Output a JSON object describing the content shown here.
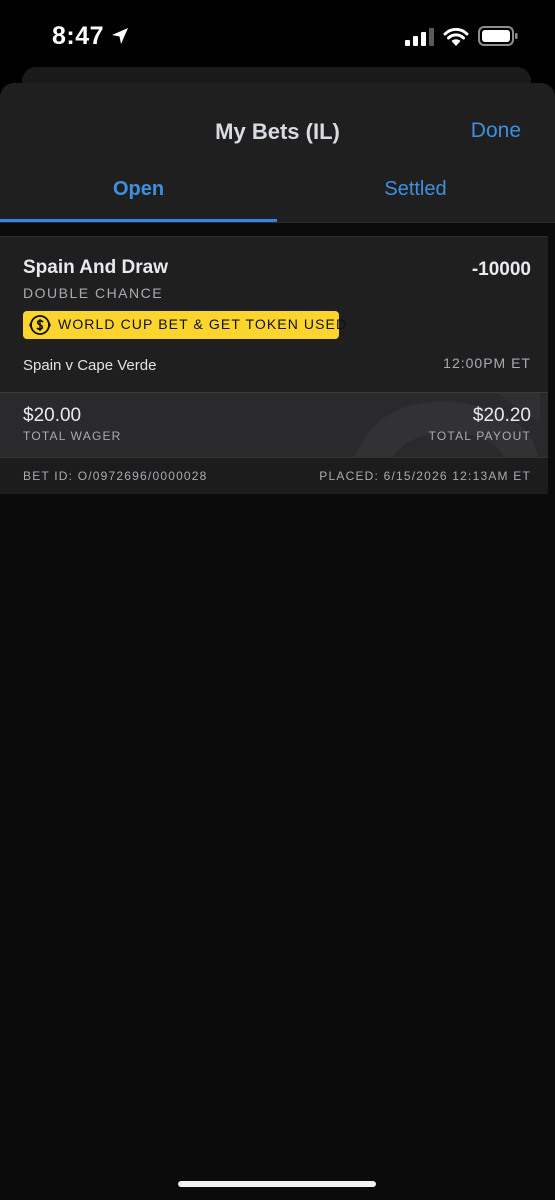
{
  "status_bar": {
    "time": "8:47"
  },
  "sheet": {
    "title": "My Bets (IL)",
    "done_label": "Done"
  },
  "tabs": [
    {
      "label": "Open",
      "active": true
    },
    {
      "label": "Settled",
      "active": false
    }
  ],
  "bet": {
    "selection": "Spain And Draw",
    "market": "DOUBLE CHANCE",
    "odds": "-10000",
    "token_badge": "WORLD CUP BET & GET TOKEN USED",
    "event": "Spain v Cape Verde",
    "event_time": "12:00PM ET",
    "wager_amount": "$20.00",
    "wager_label": "TOTAL WAGER",
    "payout_amount": "$20.20",
    "payout_label": "TOTAL PAYOUT",
    "bet_id": "BET ID: O/0972696/0000028",
    "placed": "PLACED: 6/15/2026 12:13AM ET"
  },
  "colors": {
    "accent_blue": "#3d8fe0",
    "badge_yellow": "#fbd52d",
    "sheet_bg": "#1f1f20",
    "page_bg": "#0b0b0b"
  },
  "icons": {
    "location": "location-arrow-icon",
    "signal": "cellular-signal-icon",
    "wifi": "wifi-icon",
    "battery": "battery-icon",
    "token": "token-icon"
  }
}
